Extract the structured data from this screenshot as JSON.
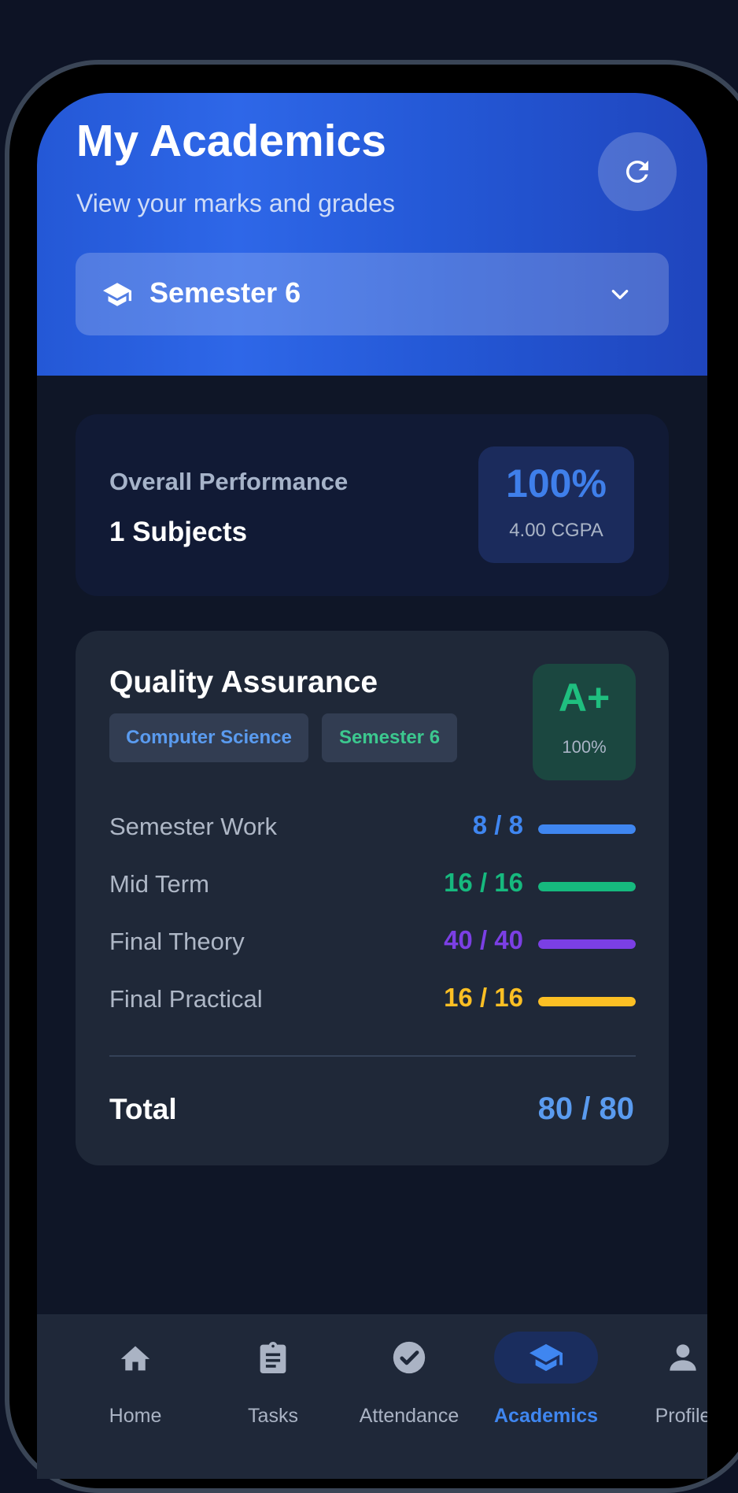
{
  "header": {
    "title": "My Academics",
    "subtitle": "View your marks and grades",
    "refresh_icon": "refresh-icon"
  },
  "semester_select": {
    "icon": "graduation-cap-icon",
    "value": "Semester 6",
    "chevron": "chevron-down-icon"
  },
  "overall": {
    "label": "Overall Performance",
    "subjects": "1 Subjects",
    "percentage": "100%",
    "cgpa": "4.00 CGPA"
  },
  "subject": {
    "name": "Quality Assurance",
    "tags": [
      "Computer Science",
      "Semester 6"
    ],
    "grade": "A+",
    "grade_percentage": "100%",
    "marks": [
      {
        "label": "Semester Work",
        "value": "8 / 8",
        "fraction": 1.0,
        "color": "#3f86f0"
      },
      {
        "label": "Mid Term",
        "value": "16 / 16",
        "fraction": 1.0,
        "color": "#16b97e"
      },
      {
        "label": "Final Theory",
        "value": "40 / 40",
        "fraction": 1.0,
        "color": "#7b3fe4"
      },
      {
        "label": "Final Practical",
        "value": "16 / 16",
        "fraction": 1.0,
        "color": "#fbbf24"
      }
    ],
    "total_label": "Total",
    "total_value": "80 / 80"
  },
  "nav": {
    "items": [
      {
        "label": "Home",
        "icon": "home-icon",
        "active": false
      },
      {
        "label": "Tasks",
        "icon": "clipboard-icon",
        "active": false
      },
      {
        "label": "Attendance",
        "icon": "check-circle-icon",
        "active": false
      },
      {
        "label": "Academics",
        "icon": "graduation-cap-icon",
        "active": true
      },
      {
        "label": "Profile",
        "icon": "person-icon",
        "active": false
      }
    ]
  },
  "colors": {
    "accent": "#3f86f0",
    "header": "#2458d6",
    "success": "#16b97e"
  }
}
